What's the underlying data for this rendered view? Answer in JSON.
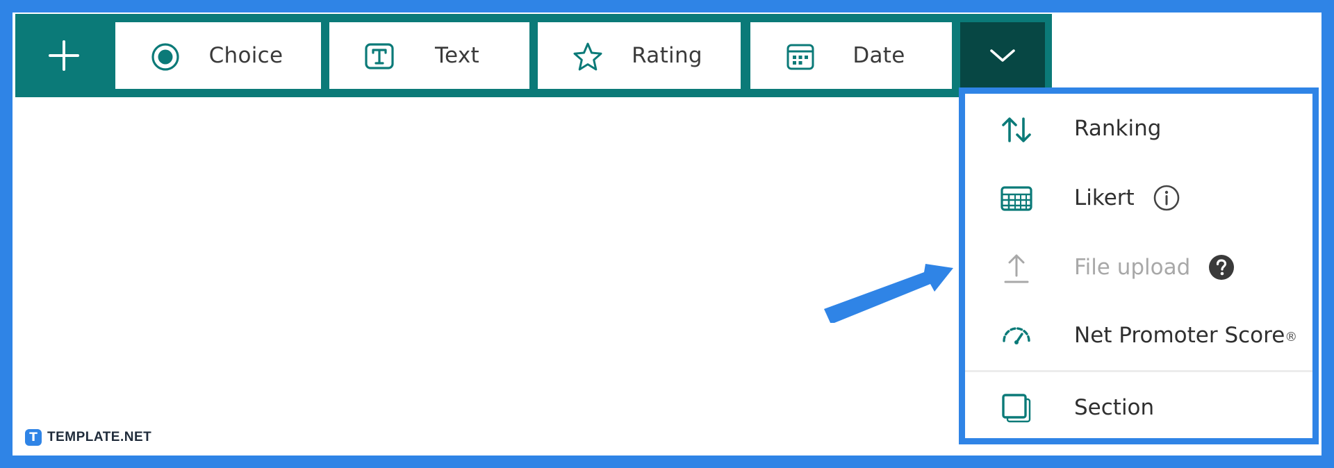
{
  "toolbar": {
    "add_icon": "plus-icon",
    "buttons": [
      {
        "label": "Choice",
        "icon": "radio-button-icon"
      },
      {
        "label": "Text",
        "icon": "text-box-icon"
      },
      {
        "label": "Rating",
        "icon": "star-icon"
      },
      {
        "label": "Date",
        "icon": "calendar-icon"
      }
    ],
    "more_icon": "chevron-down-icon"
  },
  "dropdown": {
    "items": [
      {
        "label": "Ranking",
        "icon": "sort-arrows-icon",
        "enabled": true
      },
      {
        "label": "Likert",
        "icon": "likert-grid-icon",
        "enabled": true,
        "info_icon": "info-icon"
      },
      {
        "label": "File upload",
        "icon": "upload-icon",
        "enabled": false,
        "help_icon": "help-icon"
      },
      {
        "label": "Net Promoter Score",
        "suffix": "®",
        "icon": "gauge-icon",
        "enabled": true
      },
      {
        "label": "Section",
        "icon": "section-icon",
        "enabled": true
      }
    ]
  },
  "logo": {
    "mark": "T",
    "text": "TEMPLATE.NET"
  },
  "colors": {
    "border": "#2f84e6",
    "toolbar": "#0b7a78",
    "toolbar_dark": "#074744",
    "icon": "#0b7a78"
  }
}
